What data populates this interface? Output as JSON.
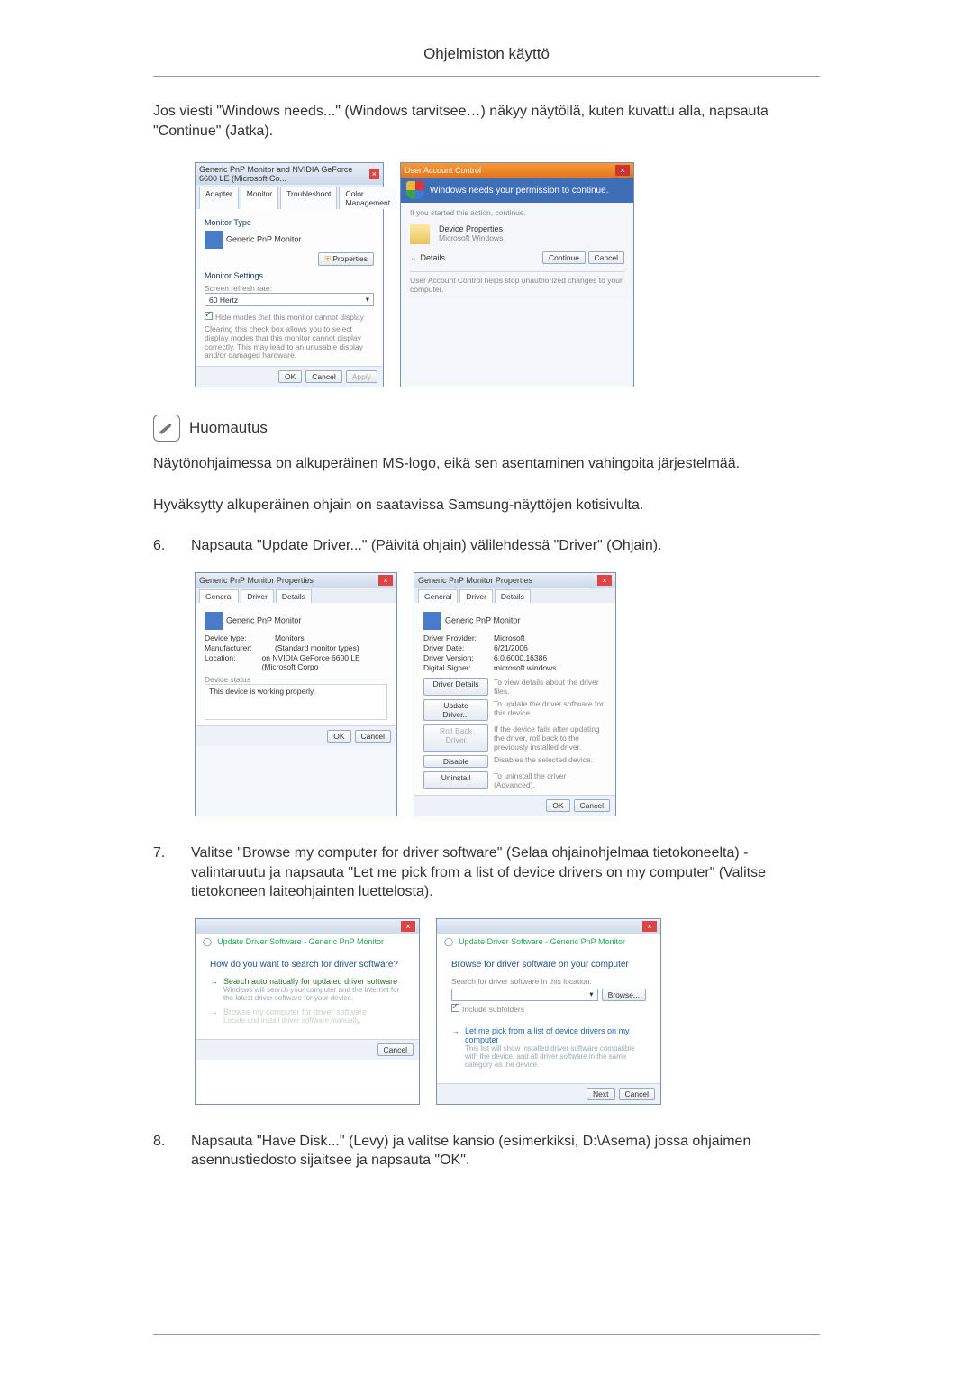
{
  "page_title": "Ohjelmiston käyttö",
  "intro_para": "Jos viesti \"Windows needs...\" (Windows tarvitsee…) näkyy näytöllä, kuten kuvattu alla, napsauta \"Continue\" (Jatka).",
  "note": {
    "label": "Huomautus",
    "p1": "Näytönohjaimessa on alkuperäinen MS-logo, eikä sen asentaminen vahingoita järjestelmää.",
    "p2": "Hyväksytty alkuperäinen ohjain on saatavissa Samsung-näyttöjen kotisivulta."
  },
  "steps": {
    "s6_num": "6.",
    "s6": "Napsauta \"Update Driver...\" (Päivitä ohjain) välilehdessä \"Driver\" (Ohjain).",
    "s7_num": "7.",
    "s7": "Valitse \"Browse my computer for driver software\" (Selaa ohjainohjelmaa tietokoneelta) -valintaruutu ja napsauta \"Let me pick from a list of device drivers on my computer\" (Valitse tietokoneen laiteohjainten luettelosta).",
    "s8_num": "8.",
    "s8": "Napsauta \"Have Disk...\" (Levy) ja valitse kansio (esimerkiksi, D:\\Asema) jossa ohjaimen asennustiedosto sijaitsee ja napsauta \"OK\"."
  },
  "fig1_left": {
    "title": "Generic PnP Monitor and NVIDIA GeForce 6600 LE (Microsoft Co...",
    "tabs": [
      "Adapter",
      "Monitor",
      "Troubleshoot",
      "Color Management"
    ],
    "monitor_type_h": "Monitor Type",
    "monitor_name": "Generic PnP Monitor",
    "properties_btn": "Properties",
    "monitor_settings_h": "Monitor Settings",
    "refresh_lbl": "Screen refresh rate:",
    "refresh_val": "60 Hertz",
    "hide_modes": "Hide modes that this monitor cannot display",
    "hide_modes_desc": "Clearing this check box allows you to select display modes that this monitor cannot display correctly. This may lead to an unusable display and/or damaged hardware.",
    "ok": "OK",
    "cancel": "Cancel",
    "apply": "Apply"
  },
  "fig1_right": {
    "title": "User Account Control",
    "headline": "Windows needs your permission to continue.",
    "started": "If you started this action, continue.",
    "prog": "Device Properties",
    "pub": "Microsoft Windows",
    "details": "Details",
    "continue": "Continue",
    "cancel": "Cancel",
    "footer": "User Account Control helps stop unauthorized changes to your computer."
  },
  "fig2_left": {
    "title": "Generic PnP Monitor Properties",
    "tabs": [
      "General",
      "Driver",
      "Details"
    ],
    "name": "Generic PnP Monitor",
    "kv": {
      "devtype_k": "Device type:",
      "devtype_v": "Monitors",
      "manu_k": "Manufacturer:",
      "manu_v": "(Standard monitor types)",
      "loc_k": "Location:",
      "loc_v": "on NVIDIA GeForce 6600 LE (Microsoft Corpo"
    },
    "status_h": "Device status",
    "status_v": "This device is working properly.",
    "ok": "OK",
    "cancel": "Cancel"
  },
  "fig2_right": {
    "title": "Generic PnP Monitor Properties",
    "tabs": [
      "General",
      "Driver",
      "Details"
    ],
    "name": "Generic PnP Monitor",
    "kv": {
      "prov_k": "Driver Provider:",
      "prov_v": "Microsoft",
      "date_k": "Driver Date:",
      "date_v": "6/21/2006",
      "ver_k": "Driver Version:",
      "ver_v": "6.0.6000.16386",
      "sig_k": "Digital Signer:",
      "sig_v": "microsoft windows"
    },
    "btns": {
      "details": "Driver Details",
      "details_d": "To view details about the driver files.",
      "update": "Update Driver...",
      "update_d": "To update the driver software for this device.",
      "rollback": "Roll Back Driver",
      "rollback_d": "If the device fails after updating the driver, roll back to the previously installed driver.",
      "disable": "Disable",
      "disable_d": "Disables the selected device.",
      "uninstall": "Uninstall",
      "uninstall_d": "To uninstall the driver (Advanced)."
    },
    "ok": "OK",
    "cancel": "Cancel"
  },
  "fig3_left": {
    "crumb": "Update Driver Software - Generic PnP Monitor",
    "q": "How do you want to search for driver software?",
    "opt1_t": "Search automatically for updated driver software",
    "opt1_d": "Windows will search your computer and the Internet for the latest driver software for your device.",
    "opt2_t": "Browse my computer for driver software",
    "opt2_d": "Locate and install driver software manually.",
    "cancel": "Cancel"
  },
  "fig3_right": {
    "crumb": "Update Driver Software - Generic PnP Monitor",
    "q": "Browse for driver software on your computer",
    "search_lbl": "Search for driver software in this location:",
    "path_val": "",
    "browse": "Browse...",
    "include": "Include subfolders",
    "opt_t": "Let me pick from a list of device drivers on my computer",
    "opt_d": "This list will show installed driver software compatible with the device, and all driver software in the same category as the device.",
    "next": "Next",
    "cancel": "Cancel"
  }
}
